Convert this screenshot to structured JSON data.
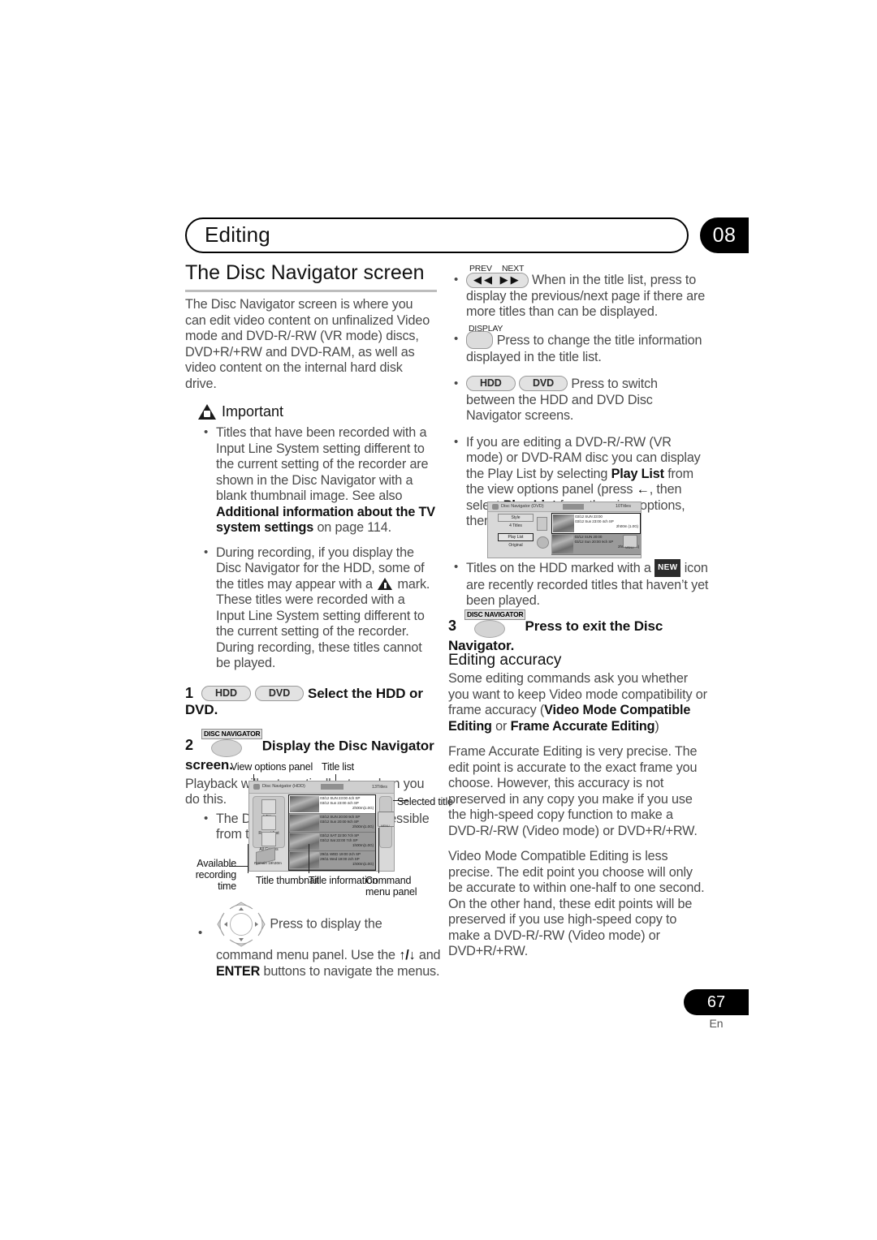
{
  "header": {
    "chapter_title": "Editing",
    "chapter_number": "08"
  },
  "left_column": {
    "section_title": "The Disc Navigator screen",
    "intro": "The Disc Navigator screen is where you can edit video content on unfinalized Video mode and DVD-R/-RW (VR mode) discs, DVD+R/+RW and DVD-RAM, as well as video content on the internal hard disk drive.",
    "important_label": "Important",
    "important_bullets": [
      {
        "pre": "Titles that have been recorded with a Input Line System setting different to the current setting of the recorder are shown in the Disc Navigator with a blank thumbnail image. See also ",
        "bold": "Additional information about the TV system settings",
        "post": " on page 114."
      },
      {
        "pre": "During recording, if you display the Disc Navigator for the HDD, some of the titles may appear with a ",
        "icon": "warning-triangle-icon",
        "post": " mark. These titles were recorded with a Input Line System setting different to the current setting of the recorder. During recording, these titles cannot be played."
      }
    ],
    "steps": [
      {
        "num": "1",
        "keys": [
          "HDD",
          "DVD"
        ],
        "text": "Select the HDD or DVD."
      },
      {
        "num": "2",
        "key_caption": "DISC NAVIGATOR",
        "text": "Display the Disc Navigator screen."
      }
    ],
    "after_step2": "Playback will automatically stop when you do this.",
    "after_step2_bullet": "The Disc Navigator is also accessible from the Home Menu.",
    "figure": {
      "callouts": {
        "view_options_panel": "View options panel",
        "title_list": "Title list",
        "selected_title": "Selected title",
        "available_recording_time": "Available recording time",
        "title_thumbnail": "Title thumbnail",
        "title_information": "Title information",
        "command_menu_panel": "Command menu panel"
      },
      "screen": {
        "window_title": "Disc Navigator (HDD)",
        "titles_count": "13Titles",
        "view_options": [
          "4 Titles",
          "Recent first",
          "All Genres"
        ],
        "remaining": "Remain 19h30m",
        "rows": [
          {
            "num": "11",
            "line1": "03/12 SUN  23:00 4ch SP",
            "line2": "03/12 Sun  23:00 4ch SP",
            "dur": "2h00m(1.0G)",
            "selected": true
          },
          {
            "num": "9",
            "line1": "03/12 SUN  20:00 9ch SP",
            "line2": "03/12 Sun  20:00 9ch SP",
            "dur": "2h00m(1.0G)",
            "selected": false
          },
          {
            "num": "8",
            "line1": "03/12 SAT  22:00 7ch SP",
            "line2": "03/12 Sat  22:00 7ch SP",
            "dur": "1h00m(1.0G)",
            "selected": false
          },
          {
            "num": "7",
            "line1": "29/11 WED  19:00 2ch SP",
            "line2": "29/11 Wed  19:00 2ch SP",
            "dur": "1h00m(1.0G)",
            "selected": false
          }
        ],
        "command_label": "MENU"
      }
    },
    "dpad_bullet": {
      "icon": "dpad-icon",
      "pre": "Press to display the command menu panel. Use the ",
      "arrows": "↑/↓",
      "mid": " and ",
      "bold": "ENTER",
      "post": " buttons to navigate the menus."
    }
  },
  "right_column": {
    "bullets": [
      {
        "key_caption_prev": "PREV",
        "key_caption_next": "NEXT",
        "key_glyphs": "◀◀   ▶▶",
        "text": "When in the title list, press to display the previous/next page if there are more titles than can be displayed."
      },
      {
        "key_caption": "DISPLAY",
        "text": "Press to change the title information displayed in the title list."
      },
      {
        "keys": [
          "HDD",
          "DVD"
        ],
        "text": "Press to switch between the HDD and DVD Disc Navigator screens."
      }
    ],
    "playlist_bullet": {
      "p1": "If you are editing a DVD-R/-RW (VR mode) or DVD-RAM disc you can display the Play List by selecting ",
      "b1": "Play List",
      "p2": " from the view options panel (press ",
      "arrow": "←",
      "p3": ", then select ",
      "b2": "Play List",
      "p4": " from the view options, then ",
      "b3": "Play List",
      "p5": ")."
    },
    "figure_dvd": {
      "window_title": "Disc Navigator (DVD)",
      "titles_count": "10Titles",
      "view_options": [
        "Style",
        "4 Titles",
        "Play List",
        "Original"
      ],
      "rows": [
        {
          "line1": "03/12 SUN  23:00",
          "line2": "03/12 Sun  23:00 4ch SP",
          "dur": "2h00m (1.0G)",
          "selected": true
        },
        {
          "line1": "03/12 SUN  20:00",
          "line2": "03/12 Sun  20:00 9ch  SP",
          "dur": "2h00m(1.0G)",
          "selected": false
        }
      ],
      "command_label": "MENU"
    },
    "new_bullet": {
      "pre": "Titles on the HDD marked with a ",
      "badge": "NEW",
      "post": " icon are recently recorded titles that haven’t yet been played."
    },
    "step3": {
      "num": "3",
      "key_caption": "DISC NAVIGATOR",
      "text": "Press to exit the Disc Navigator."
    },
    "accuracy": {
      "title": "Editing accuracy",
      "p1_pre": "Some editing commands ask you whether you want to keep Video mode compatibility or frame accuracy (",
      "p1_b1": "Video Mode Compatible Editing",
      "p1_mid": " or ",
      "p1_b2": "Frame Accurate Editing",
      "p1_post": ")",
      "p2": "Frame Accurate Editing is very precise. The edit point is accurate to the exact frame you choose. However, this accuracy is not preserved in any copy you make if you use the high-speed copy function to make a DVD-R/-RW (Video mode) or DVD+R/+RW.",
      "p3": "Video Mode Compatible Editing is less precise. The edit point you choose will only be accurate to within one-half to one second. On the other hand, these edit points will be preserved if you use high-speed copy to make a DVD-R/-RW (Video mode) or DVD+R/+RW."
    }
  },
  "footer": {
    "page_number": "67",
    "language": "En"
  }
}
